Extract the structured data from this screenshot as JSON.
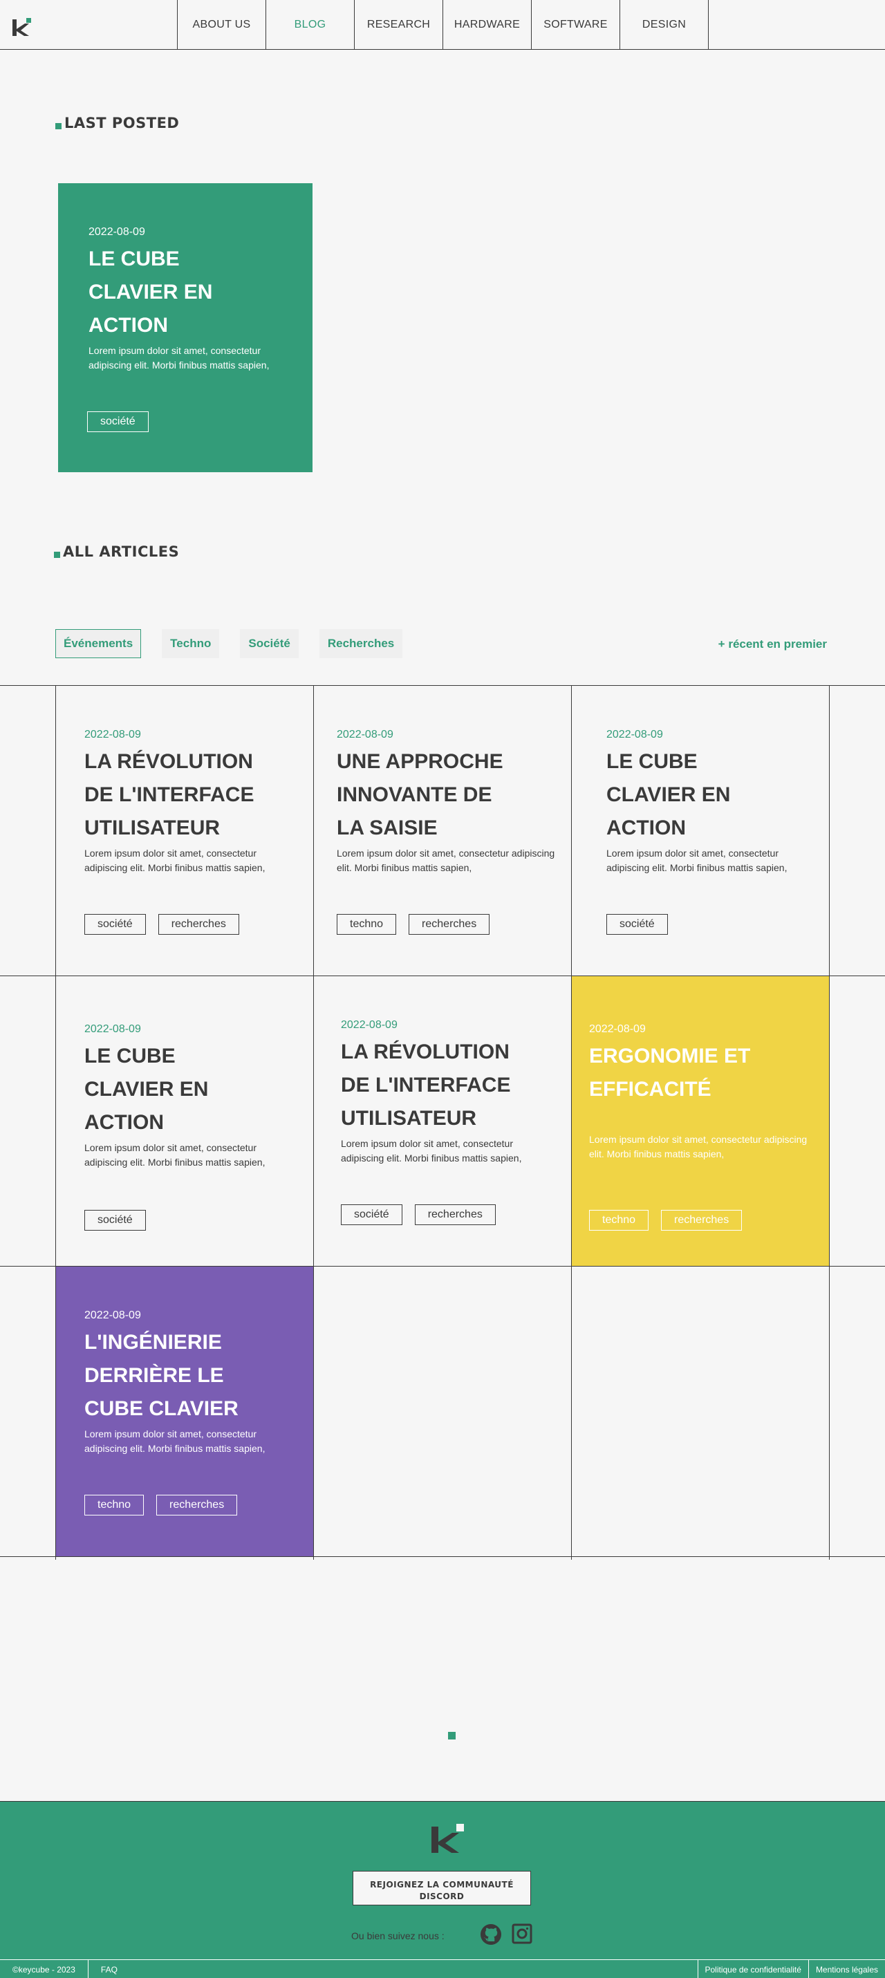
{
  "nav": {
    "logo_text": "k",
    "items": [
      {
        "label": "ABOUT US"
      },
      {
        "label": "BLOG"
      },
      {
        "label": "RESEARCH"
      },
      {
        "label": "HARDWARE"
      },
      {
        "label": "SOFTWARE"
      },
      {
        "label": "DESIGN"
      }
    ],
    "active_index": 1
  },
  "last_posted": {
    "title": "LAST POSTED",
    "card": {
      "date": "2022-08-09",
      "title": "LE CUBE CLAVIER EN ACTION",
      "excerpt": "Lorem ipsum dolor sit amet, consectetur adipiscing elit. Morbi finibus mattis sapien,",
      "tags": [
        "société"
      ],
      "color": "#339c79"
    }
  },
  "all_articles": {
    "title": "ALL ARTICLES",
    "filters": [
      "Événements",
      "Techno",
      "Société",
      "Recherches"
    ],
    "active_filter": 0,
    "sort_label": "+ récent en premier",
    "cards": [
      {
        "date": "2022-08-09",
        "title": "LA RÉVOLUTION DE L'INTERFACE UTILISATEUR",
        "excerpt": "Lorem ipsum dolor sit amet, consectetur adipiscing elit. Morbi finibus mattis sapien,",
        "tags": [
          "société",
          "recherches"
        ],
        "variant": "plain"
      },
      {
        "date": "2022-08-09",
        "title": "UNE APPROCHE INNOVANTE DE LA SAISIE",
        "excerpt": "Lorem ipsum dolor sit amet, consectetur adipiscing elit. Morbi finibus mattis sapien,",
        "tags": [
          "techno",
          "recherches"
        ],
        "variant": "plain"
      },
      {
        "date": "2022-08-09",
        "title": "LE CUBE CLAVIER EN ACTION",
        "excerpt": "Lorem ipsum dolor sit amet, consectetur adipiscing elit. Morbi finibus mattis sapien,",
        "tags": [
          "société"
        ],
        "variant": "plain"
      },
      {
        "date": "2022-08-09",
        "title": "LE CUBE CLAVIER EN ACTION",
        "excerpt": "Lorem ipsum dolor sit amet, consectetur adipiscing elit. Morbi finibus mattis sapien,",
        "tags": [
          "société"
        ],
        "variant": "plain"
      },
      {
        "date": "2022-08-09",
        "title": "LA RÉVOLUTION DE L'INTERFACE UTILISATEUR",
        "excerpt": "Lorem ipsum dolor sit amet, consectetur adipiscing elit. Morbi finibus mattis sapien,",
        "tags": [
          "société",
          "recherches"
        ],
        "variant": "plain"
      },
      {
        "date": "2022-08-09",
        "title": "ERGONOMIE ET EFFICACITÉ",
        "excerpt": "Lorem ipsum dolor sit amet, consectetur adipiscing elit. Morbi finibus mattis sapien,",
        "tags": [
          "techno",
          "recherches"
        ],
        "variant": "yellow"
      },
      {
        "date": "2022-08-09",
        "title": "L'INGÉNIERIE DERRIÈRE LE CUBE CLAVIER",
        "excerpt": "Lorem ipsum dolor sit amet, consectetur adipiscing elit. Morbi finibus mattis sapien,",
        "tags": [
          "techno",
          "recherches"
        ],
        "variant": "purple"
      }
    ]
  },
  "colors": {
    "accent": "#339c79",
    "yellow": "#f0d445",
    "purple": "#7a5db3",
    "text": "#3a3a3a",
    "background": "#f6f6f6"
  },
  "footer": {
    "join_label": "REJOIGNEZ LA COMMUNAUTÉ DISCORD",
    "follow_label": "Ou bien suivez nous :",
    "social_icons": [
      "github-icon",
      "instagram-icon"
    ],
    "copyright": "©keycube - 2023",
    "faq": "FAQ",
    "privacy": "Politique de confidentialité",
    "legal": "Mentions légales"
  }
}
